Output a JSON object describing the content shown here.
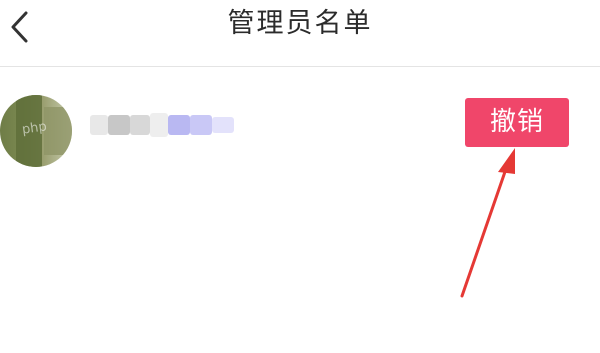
{
  "header": {
    "title": "管理员名单",
    "back_icon": "chevron-left-icon"
  },
  "admin_list": {
    "rows": [
      {
        "revoke_label": "撤销"
      }
    ]
  },
  "colors": {
    "accent": "#f0466a",
    "annotation_arrow": "#e53935",
    "title_text": "#2b2b2b",
    "divider": "#e4e4e4"
  }
}
